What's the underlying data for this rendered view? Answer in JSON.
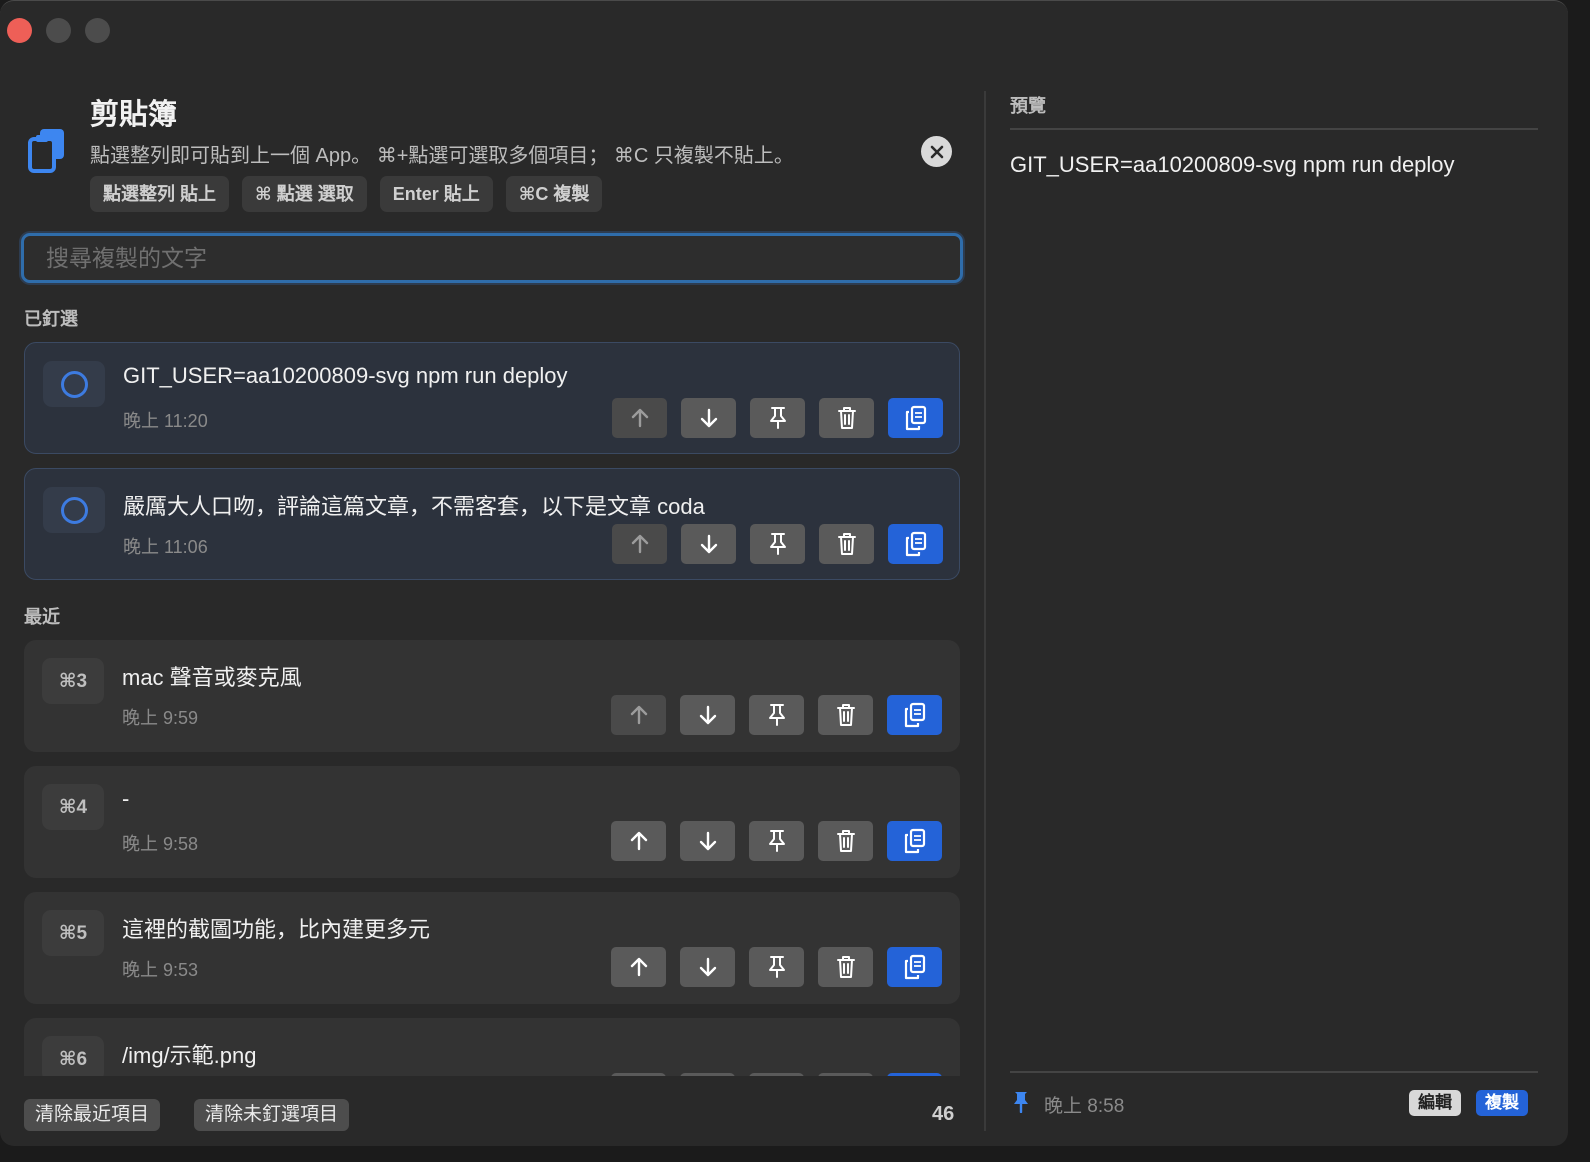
{
  "header": {
    "title": "剪貼簿",
    "subtitle": "點選整列即可貼到上一個 App。 ⌘+點選可選取多個項目； ⌘C 只複製不貼上。",
    "chips": [
      "點選整列  貼上",
      "⌘ 點選  選取",
      "Enter  貼上",
      "⌘C  複製"
    ]
  },
  "search": {
    "placeholder": "搜尋複製的文字",
    "value": ""
  },
  "sections": {
    "pinned": "已釘選",
    "recent": "最近"
  },
  "pinned_items": [
    {
      "text": "GIT_USER=aa10200809-svg npm run deploy",
      "time": "晚上 11:20"
    },
    {
      "text": "嚴厲大人口吻，評論這篇文章，不需客套，以下是文章 coda",
      "time": "晚上 11:06"
    }
  ],
  "recent_items": [
    {
      "shortcut": "⌘3",
      "text": "mac 聲音或麥克風",
      "time": "晚上 9:59"
    },
    {
      "shortcut": "⌘4",
      "text": "-",
      "time": "晚上 9:58"
    },
    {
      "shortcut": "⌘5",
      "text": "這裡的截圖功能，比內建更多元",
      "time": "晚上 9:53"
    },
    {
      "shortcut": "⌘6",
      "text": "/img/示範.png",
      "time": ""
    }
  ],
  "footer": {
    "clear_recent": "清除最近項目",
    "clear_unpinned": "清除未釘選項目",
    "count": "46"
  },
  "preview": {
    "label": "預覽",
    "text": "GIT_USER=aa10200809-svg npm run deploy",
    "time": "晚上 8:58",
    "edit": "編輯",
    "copy": "複製"
  },
  "icons": {
    "app": "clipboard-icon",
    "move_up": "arrow-up-icon",
    "move_down": "arrow-down-icon",
    "pin": "pin-icon",
    "delete": "trash-icon",
    "copy": "copy-icon",
    "close": "close-icon"
  },
  "colors": {
    "accent": "#2463d8",
    "focus_ring": "#2f6dab",
    "close_light": "#ee5f57"
  }
}
